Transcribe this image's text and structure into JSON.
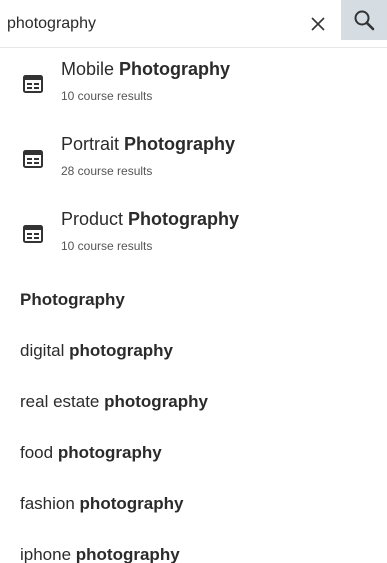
{
  "search": {
    "value": "photography",
    "clear_icon": "close-icon",
    "search_icon": "search-icon",
    "search_button_bg": "#d5dde3"
  },
  "courses": [
    {
      "prefix": "Mobile ",
      "highlight": "Photography",
      "results": "10 course results",
      "icon": "course-icon"
    },
    {
      "prefix": "Portrait ",
      "highlight": "Photography",
      "results": "28 course results",
      "icon": "course-icon"
    },
    {
      "prefix": "Product ",
      "highlight": "Photography",
      "results": "10 course results",
      "icon": "course-icon"
    }
  ],
  "suggestions": [
    {
      "prefix": "",
      "highlight": "Photography"
    },
    {
      "prefix": "digital ",
      "highlight": "photography"
    },
    {
      "prefix": "real estate ",
      "highlight": "photography"
    },
    {
      "prefix": "food ",
      "highlight": "photography"
    },
    {
      "prefix": "fashion ",
      "highlight": "photography"
    },
    {
      "prefix": "iphone ",
      "highlight": "photography"
    }
  ]
}
